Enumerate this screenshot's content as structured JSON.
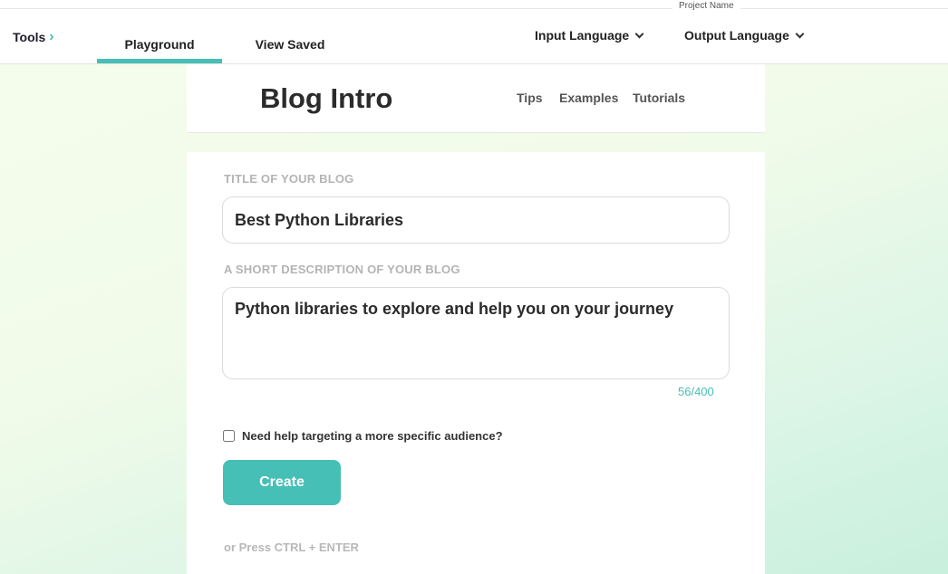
{
  "topbar": {
    "project_name": "Project Name",
    "tools_label": "Tools",
    "tabs": [
      {
        "label": "Playground",
        "active": true
      },
      {
        "label": "View Saved",
        "active": false
      }
    ],
    "input_language_label": "Input Language",
    "output_language_label": "Output Language"
  },
  "header": {
    "title": "Blog Intro",
    "links": [
      "Tips",
      "Examples",
      "Tutorials"
    ]
  },
  "form": {
    "title_label": "TITLE OF YOUR BLOG",
    "title_value": "Best Python Libraries",
    "description_label": "A SHORT DESCRIPTION OF YOUR BLOG",
    "description_value": "Python libraries to explore and help you on your journey",
    "char_count": "56/400",
    "audience_checkbox_label": "Need help targeting a more specific audience?",
    "audience_checked": false,
    "create_label": "Create",
    "shortcut_hint": "or Press CTRL + ENTER"
  },
  "colors": {
    "accent": "#46bfb6"
  }
}
